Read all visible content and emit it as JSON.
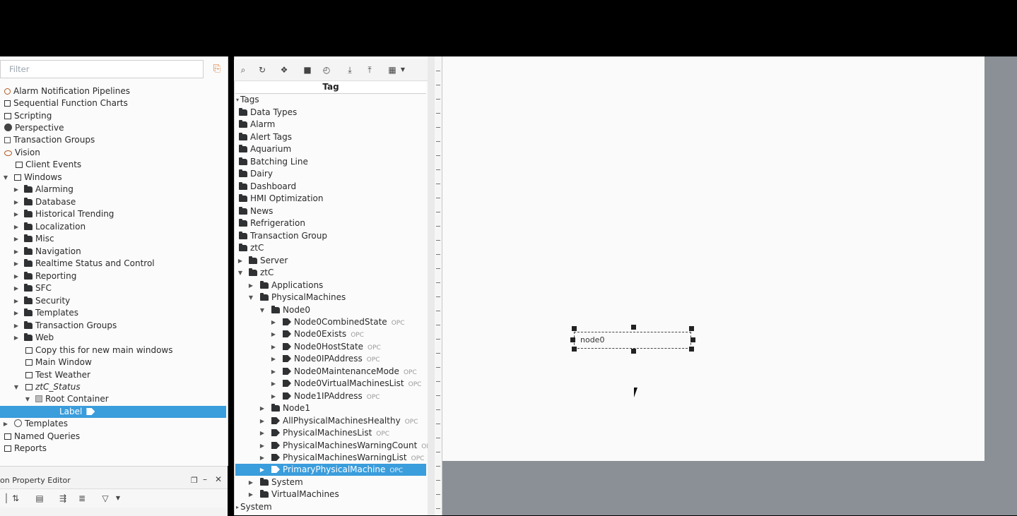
{
  "project_browser": {
    "filter_placeholder": "Filter",
    "items": [
      {
        "label": "Alarm Notification Pipelines",
        "icon": "pipeline-icon"
      },
      {
        "label": "Sequential Function Charts",
        "icon": "sfc-icon"
      },
      {
        "label": "Scripting",
        "icon": "script-icon"
      },
      {
        "label": "Perspective",
        "icon": "perspective-icon"
      },
      {
        "label": "Transaction Groups",
        "icon": "transaction-icon"
      },
      {
        "label": "Vision",
        "icon": "eye-icon"
      },
      {
        "label": "Client Events",
        "icon": "client-events-icon"
      },
      {
        "label": "Windows",
        "icon": "window-icon"
      },
      {
        "label": "Alarming",
        "icon": "folder-icon"
      },
      {
        "label": "Database",
        "icon": "folder-icon"
      },
      {
        "label": "Historical Trending",
        "icon": "folder-icon"
      },
      {
        "label": "Localization",
        "icon": "folder-icon"
      },
      {
        "label": "Misc",
        "icon": "folder-icon"
      },
      {
        "label": "Navigation",
        "icon": "folder-icon"
      },
      {
        "label": "Realtime Status and Control",
        "icon": "folder-icon"
      },
      {
        "label": "Reporting",
        "icon": "folder-icon"
      },
      {
        "label": "SFC",
        "icon": "folder-icon"
      },
      {
        "label": "Security",
        "icon": "folder-icon"
      },
      {
        "label": "Templates",
        "icon": "folder-icon"
      },
      {
        "label": "Transaction Groups",
        "icon": "folder-icon"
      },
      {
        "label": "Web",
        "icon": "folder-icon"
      },
      {
        "label": "Copy this for new main windows",
        "icon": "window-icon"
      },
      {
        "label": "Main Window",
        "icon": "window-icon"
      },
      {
        "label": "Test Weather",
        "icon": "window-icon"
      },
      {
        "label": "ztC_Status",
        "icon": "window-icon"
      },
      {
        "label": "Root Container",
        "icon": "container-icon"
      },
      {
        "label": "Label",
        "icon": "label-icon"
      },
      {
        "label": "Templates",
        "icon": "templates-icon"
      },
      {
        "label": "Named Queries",
        "icon": "queries-icon"
      },
      {
        "label": "Reports",
        "icon": "reports-icon"
      }
    ]
  },
  "property_editor": {
    "title": "on Property Editor"
  },
  "tag_browser": {
    "column_header": "Tag",
    "items": [
      {
        "label": "Tags",
        "badge": ""
      },
      {
        "label": "Data Types",
        "badge": ""
      },
      {
        "label": "Alarm",
        "badge": ""
      },
      {
        "label": "Alert Tags",
        "badge": ""
      },
      {
        "label": "Aquarium",
        "badge": ""
      },
      {
        "label": "Batching Line",
        "badge": ""
      },
      {
        "label": "Dairy",
        "badge": ""
      },
      {
        "label": "Dashboard",
        "badge": ""
      },
      {
        "label": "HMI Optimization",
        "badge": ""
      },
      {
        "label": "News",
        "badge": ""
      },
      {
        "label": "Refrigeration",
        "badge": ""
      },
      {
        "label": "Transaction Group",
        "badge": ""
      },
      {
        "label": "ztC",
        "badge": ""
      },
      {
        "label": "Server",
        "badge": ""
      },
      {
        "label": "ztC",
        "badge": ""
      },
      {
        "label": "Applications",
        "badge": ""
      },
      {
        "label": "PhysicalMachines",
        "badge": ""
      },
      {
        "label": "Node0",
        "badge": ""
      },
      {
        "label": "Node0CombinedState",
        "badge": "OPC"
      },
      {
        "label": "Node0Exists",
        "badge": "OPC"
      },
      {
        "label": "Node0HostState",
        "badge": "OPC"
      },
      {
        "label": "Node0IPAddress",
        "badge": "OPC"
      },
      {
        "label": "Node0MaintenanceMode",
        "badge": "OPC"
      },
      {
        "label": "Node0VirtualMachinesList",
        "badge": "OPC"
      },
      {
        "label": "Node1IPAddress",
        "badge": "OPC"
      },
      {
        "label": "Node1",
        "badge": ""
      },
      {
        "label": "AllPhysicalMachinesHealthy",
        "badge": "OPC"
      },
      {
        "label": "PhysicalMachinesList",
        "badge": "OPC"
      },
      {
        "label": "PhysicalMachinesWarningCount",
        "badge": "OPC"
      },
      {
        "label": "PhysicalMachinesWarningList",
        "badge": "OPC"
      },
      {
        "label": "PrimaryPhysicalMachine",
        "badge": "OPC"
      },
      {
        "label": "System",
        "badge": ""
      },
      {
        "label": "VirtualMachines",
        "badge": ""
      },
      {
        "label": "System",
        "badge": ""
      }
    ]
  },
  "designer": {
    "widget_text": "node0"
  },
  "colors": {
    "selection": "#3a9ddc",
    "canvas_bg": "#fafafa",
    "workspace_bg": "#8a9095"
  }
}
